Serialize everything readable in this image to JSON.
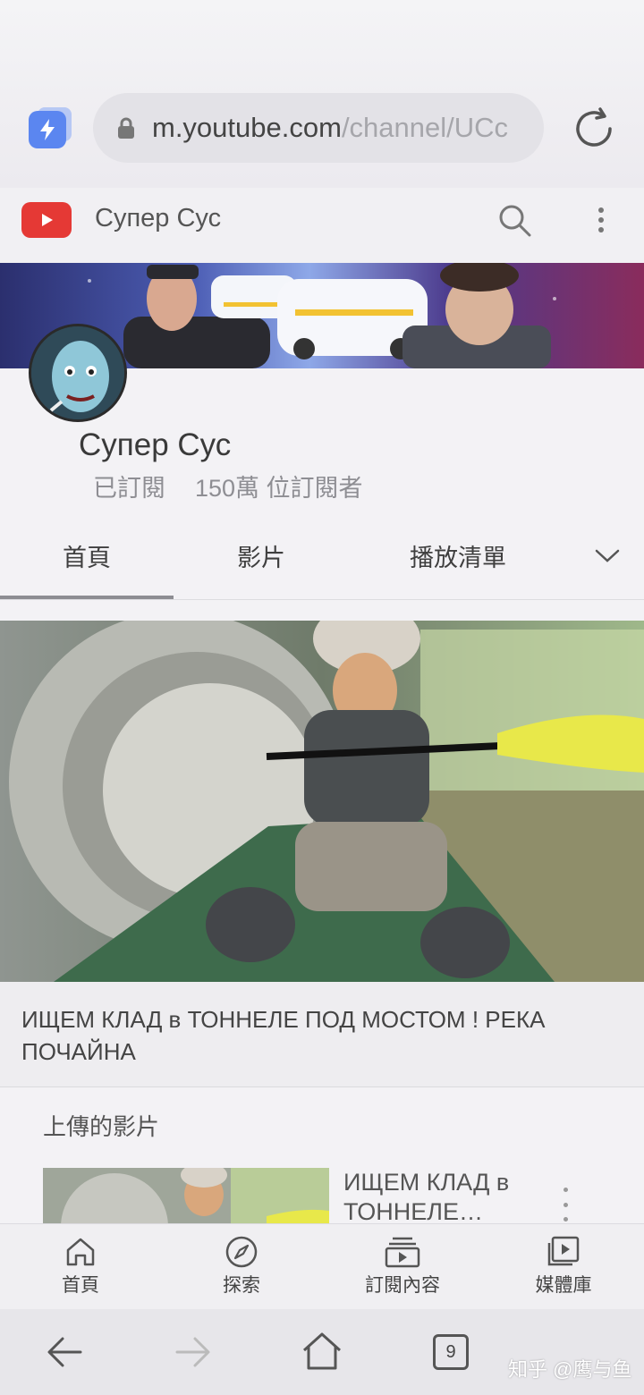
{
  "browser": {
    "url_host": "m.youtube.com",
    "url_path": "/channel/UCc",
    "tab_count": "9"
  },
  "header": {
    "title": "Супер Сус"
  },
  "channel": {
    "name": "Супер Сус",
    "subscription_status": "已訂閱",
    "subscriber_count": "150萬 位訂閱者"
  },
  "tabs": [
    {
      "label": "首頁",
      "active": true
    },
    {
      "label": "影片",
      "active": false
    },
    {
      "label": "播放清單",
      "active": false
    }
  ],
  "featured": {
    "title": "ИЩЕМ КЛАД в ТОННЕЛЕ ПОД МОСТОМ ! РЕКА ПОЧАЙНА"
  },
  "uploads": {
    "heading": "上傳的影片",
    "items": [
      {
        "title": "ИЩЕМ КЛАД в ТОННЕЛЕ…"
      }
    ]
  },
  "bottom_nav": [
    {
      "label": "首頁",
      "icon": "home-icon"
    },
    {
      "label": "探索",
      "icon": "compass-icon"
    },
    {
      "label": "訂閱內容",
      "icon": "subscriptions-icon"
    },
    {
      "label": "媒體庫",
      "icon": "library-icon"
    }
  ],
  "watermark": "知乎 @鹰与鱼",
  "colors": {
    "youtube_red": "#e53935",
    "bolt_blue": "#5b86f0",
    "paddle_yellow": "#e8e84a"
  }
}
